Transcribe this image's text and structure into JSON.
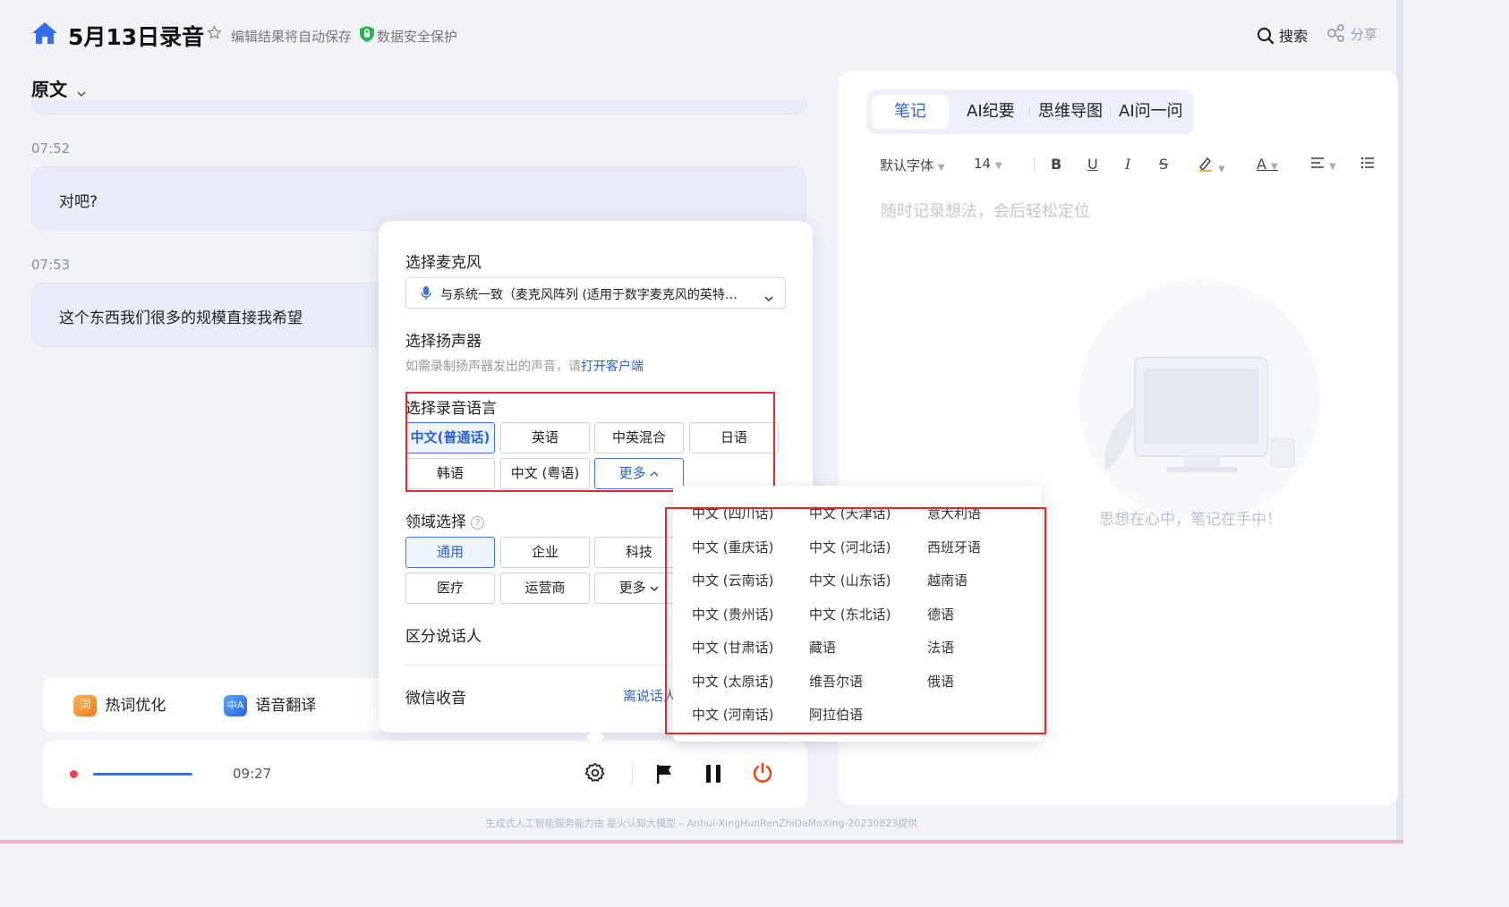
{
  "header": {
    "title": "5月13日录音",
    "autosave": "编辑结果将自动保存",
    "security": "数据安全保护",
    "search_label": "搜索",
    "share_label": "分享"
  },
  "transcript": {
    "view_label": "原文",
    "items": [
      {
        "time": "07:52",
        "text": "对吧?"
      },
      {
        "time": "07:53",
        "text": "这个东西我们很多的规模直接我希望"
      }
    ]
  },
  "tools": {
    "hotword": "热词优化",
    "translate": "语音翻译",
    "hotword_icon_text": "词",
    "translate_icon_text": "中A"
  },
  "recorder": {
    "elapsed": "09:27"
  },
  "footer": "生成式人工智能服务能力由 星火认知大模型 – Anhui-XingHuoRenZhiDaMoXing-20230823提供",
  "notes": {
    "tabs": [
      "笔记",
      "AI纪要",
      "思维导图",
      "AI问一问"
    ],
    "active_tab": 0,
    "font_label": "默认字体",
    "size_label": "14",
    "placeholder": "随时记录想法，会后轻松定位",
    "empty_text": "思想在心中，笔记在手中！"
  },
  "settings": {
    "mic_title": "选择麦克风",
    "mic_value": "与系统一致（麦克风阵列 (适用于数字麦克风的英特…",
    "speaker_title": "选择扬声器",
    "speaker_hint": "如需录制扬声器发出的声音，请",
    "speaker_link": "打开客户端",
    "lang_title": "选择录音语言",
    "languages": [
      "中文(普通话)",
      "英语",
      "中英混合",
      "日语",
      "韩语",
      "中文 (粤语)"
    ],
    "lang_more": "更多",
    "domain_title": "领域选择",
    "domains": [
      "通用",
      "企业",
      "科技",
      "医疗",
      "运营商"
    ],
    "domain_more": "更多",
    "speaker_diarize": "区分说话人",
    "wechat_capture": "微信收音",
    "wechat_link": "离说话人"
  },
  "more_languages": {
    "col1": [
      "中文 (四川话)",
      "中文 (重庆话)",
      "中文 (云南话)",
      "中文 (贵州话)",
      "中文 (甘肃话)",
      "中文 (太原话)",
      "中文 (河南话)"
    ],
    "col2": [
      "中文 (天津话)",
      "中文 (河北话)",
      "中文 (山东话)",
      "中文 (东北话)",
      "藏语",
      "维吾尔语",
      "阿拉伯语"
    ],
    "col3": [
      "意大利语",
      "西班牙语",
      "越南语",
      "德语",
      "法语",
      "俄语"
    ]
  },
  "colors": {
    "accent": "#2b63d9",
    "stop_red": "#ea4a15",
    "highlight_box": "#e62a2a"
  }
}
